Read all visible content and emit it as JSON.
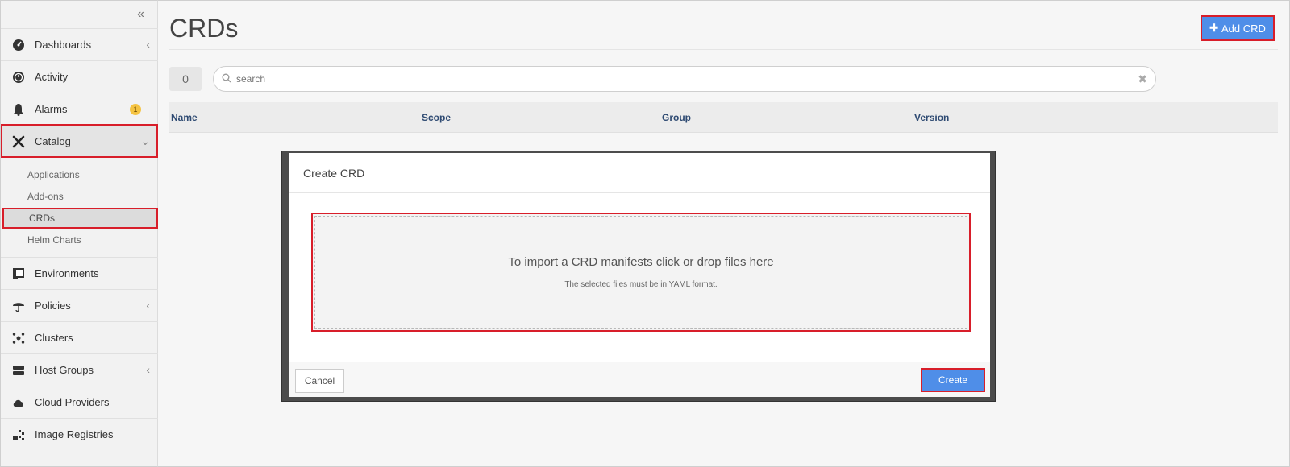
{
  "sidebar": {
    "collapse_glyph": "«",
    "items": [
      {
        "label": "Dashboards",
        "icon": "dashboard-icon"
      },
      {
        "label": "Activity",
        "icon": "activity-icon"
      },
      {
        "label": "Alarms",
        "icon": "bell-icon",
        "badge": "1"
      },
      {
        "label": "Catalog",
        "icon": "catalog-icon"
      },
      {
        "label": "Environments",
        "icon": "environments-icon"
      },
      {
        "label": "Policies",
        "icon": "umbrella-icon"
      },
      {
        "label": "Clusters",
        "icon": "clusters-icon"
      },
      {
        "label": "Host Groups",
        "icon": "server-icon"
      },
      {
        "label": "Cloud Providers",
        "icon": "cloud-icon"
      },
      {
        "label": "Image Registries",
        "icon": "registry-icon"
      }
    ],
    "catalog_sub": [
      {
        "label": "Applications"
      },
      {
        "label": "Add-ons"
      },
      {
        "label": "CRDs"
      },
      {
        "label": "Helm Charts"
      }
    ]
  },
  "main": {
    "title": "CRDs",
    "add_button": "Add CRD",
    "count": "0",
    "search": {
      "placeholder": "search"
    },
    "table": {
      "headers": [
        "Name",
        "Scope",
        "Group",
        "Version"
      ]
    }
  },
  "modal": {
    "title": "Create CRD",
    "dropzone_title": "To import a CRD manifests click or drop files here",
    "dropzone_sub": "The selected files must be in YAML format.",
    "cancel": "Cancel",
    "create": "Create"
  },
  "colors": {
    "accent": "#4f8ee8",
    "highlight": "#d81e2a",
    "badge": "#f5c341"
  }
}
